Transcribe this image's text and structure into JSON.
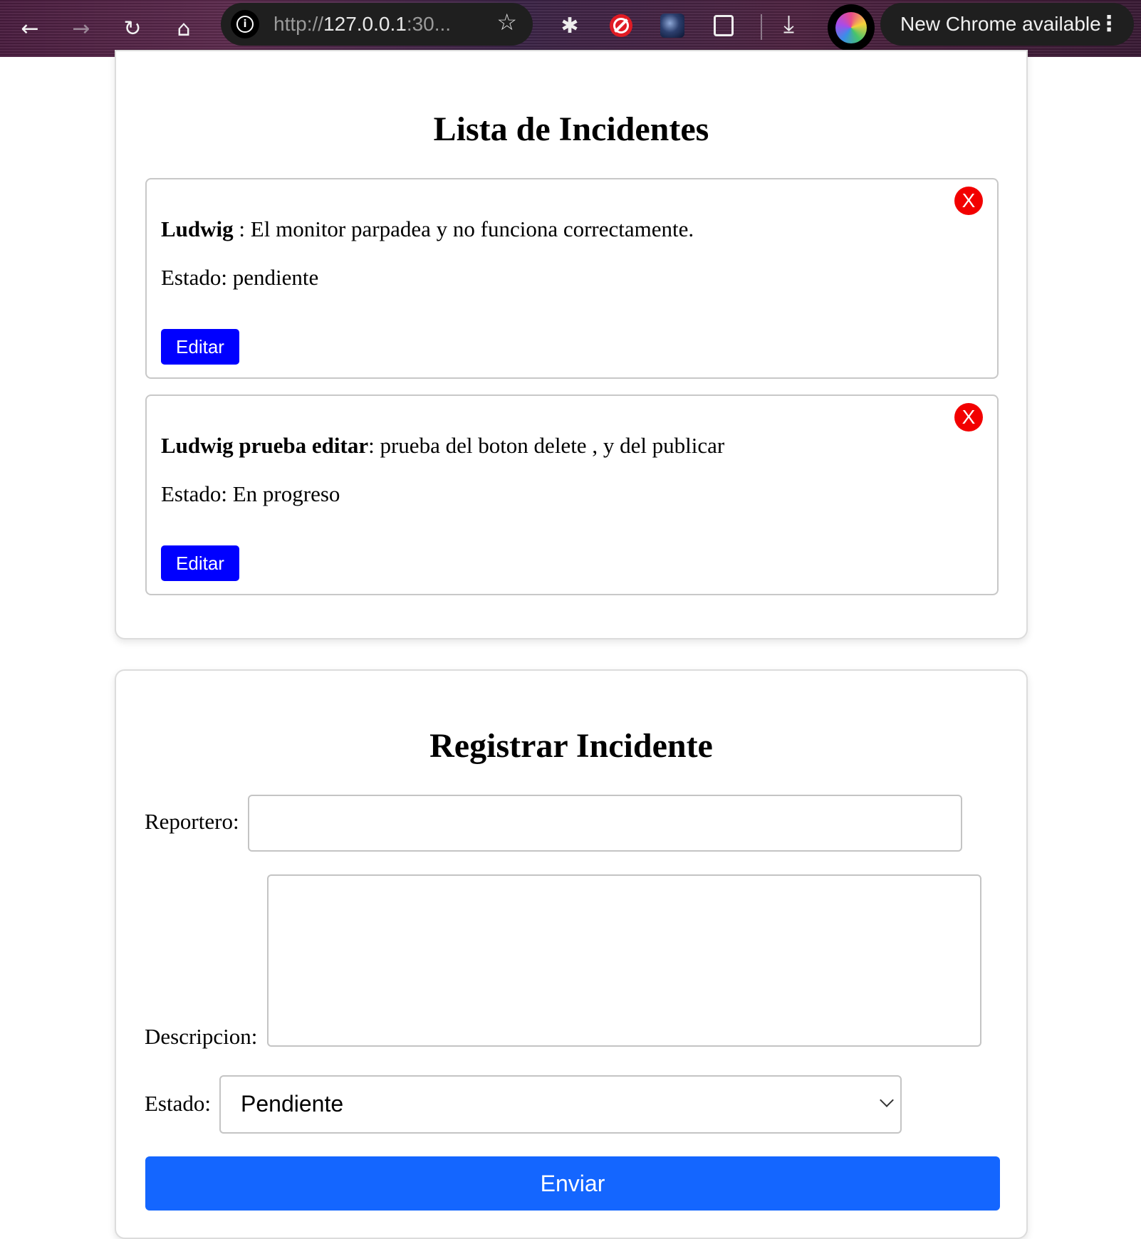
{
  "browser": {
    "url_scheme": "http://",
    "url_host": "127.0.0.1",
    "url_rest": ":30...",
    "update_label": "New Chrome available",
    "icons": {
      "back": "arrow-left-icon",
      "forward": "arrow-right-icon",
      "reload": "reload-icon",
      "home": "home-icon",
      "info": "info-icon",
      "bookmark": "star-icon",
      "downloads": "download-icon",
      "menu": "kebab-menu-icon"
    }
  },
  "list": {
    "title": "Lista de Incidentes",
    "incidents": [
      {
        "reporter": "Ludwig",
        "separator": " : ",
        "description": "El monitor parpadea y no funciona correctamente.",
        "status_text": "Estado: pendiente",
        "delete_label": "X",
        "edit_label": "Editar"
      },
      {
        "reporter": "Ludwig prueba editar",
        "separator": ": ",
        "description": "prueba del boton delete , y del publicar",
        "status_text": "Estado: En progreso",
        "delete_label": "X",
        "edit_label": "Editar"
      }
    ]
  },
  "form": {
    "title": "Registrar Incidente",
    "reporter_label": "Reportero:",
    "reporter_value": "",
    "description_label": "Descripcion:",
    "description_value": "",
    "status_label": "Estado:",
    "status_selected": "Pendiente",
    "submit_label": "Enviar"
  },
  "colors": {
    "edit_button": "#0000ff",
    "delete_button": "#f20000",
    "submit_button": "#1466ff"
  }
}
